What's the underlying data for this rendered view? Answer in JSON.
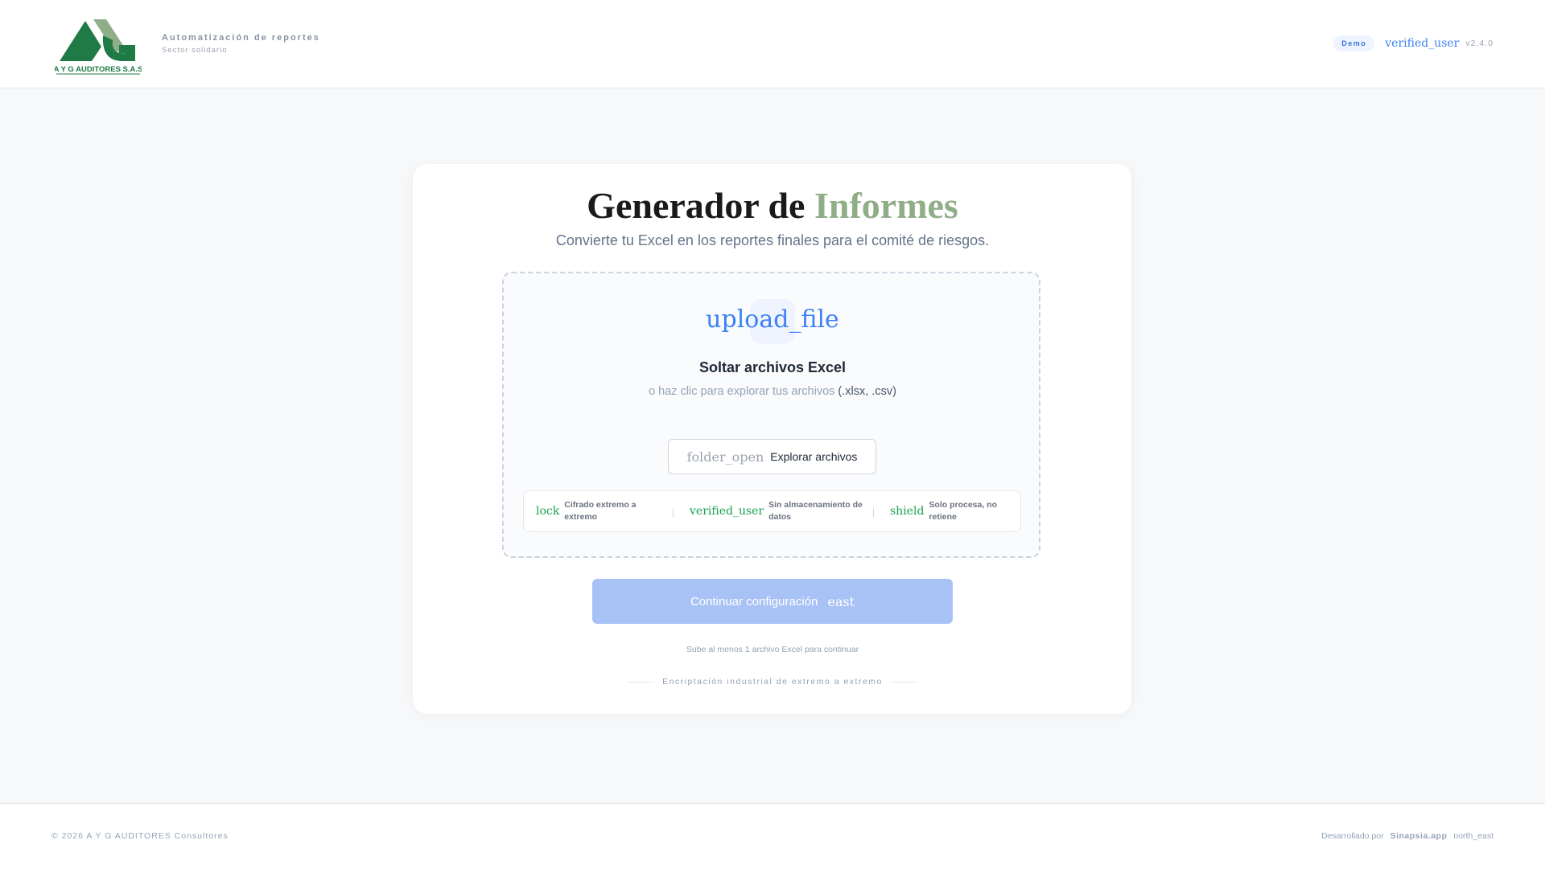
{
  "header": {
    "logo_text": "A Y G AUDITORES S.A.S",
    "title": "Automatización de reportes",
    "subtitle": "Sector solidario",
    "badge": "Demo",
    "verified_icon": "verified_user",
    "version": "v2.4.0"
  },
  "main": {
    "title_part1": "Generador de",
    "title_part2": "Informes",
    "subtitle": "Convierte tu Excel en los reportes finales para el comité de riesgos.",
    "upload_icon": "upload_file",
    "drop_title": "Soltar archivos Excel",
    "drop_hint": "o haz clic para explorar tus archivos",
    "drop_ext": "(.xlsx, .csv)",
    "browse_icon": "folder_open",
    "browse_label": "Explorar archivos",
    "features": [
      {
        "icon": "lock",
        "label": "Cifrado extremo a extremo"
      },
      {
        "icon": "verified_user",
        "label": "Sin almacenamiento de datos"
      },
      {
        "icon": "shield",
        "label": "Solo procesa, no retiene"
      }
    ],
    "separator": "|",
    "continue_label": "Continuar configuración",
    "continue_icon": "east",
    "continue_hint": "Sube al menos 1 archivo Excel para continuar",
    "encryption_text": "Encriptación industrial de extremo a extremo"
  },
  "footer": {
    "copyright": "© 2026 A Y G AUDITORES Consultores",
    "dev_prefix": "Desarrollado por",
    "dev_brand": "Sinapsia.app",
    "dev_icon": "north_east"
  },
  "colors": {
    "accent": "#8fae88",
    "primary": "#3b82f6",
    "button_disabled": "#a8c2f5",
    "logo_green": "#1f7a45"
  }
}
